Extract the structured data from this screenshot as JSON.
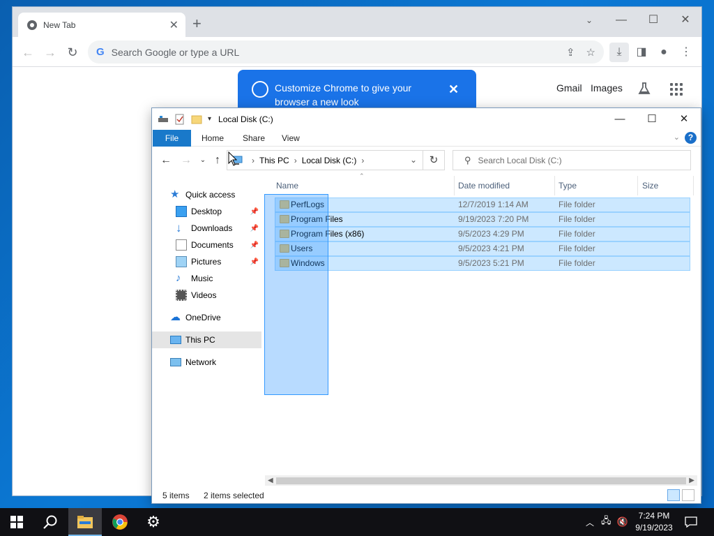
{
  "chrome": {
    "tab_title": "New Tab",
    "omnibox_placeholder": "Search Google or type a URL",
    "google_g": "G",
    "links": {
      "gmail": "Gmail",
      "images": "Images"
    },
    "promo_text": "Customize Chrome to give your browser a new look"
  },
  "explorer": {
    "title": "Local Disk (C:)",
    "ribbon_tabs": [
      "File",
      "Home",
      "Share",
      "View"
    ],
    "help": "?",
    "breadcrumb": [
      "This PC",
      "Local Disk (C:)"
    ],
    "search_placeholder": "Search Local Disk (C:)",
    "nav": [
      {
        "label": "Quick access"
      },
      {
        "label": "Desktop",
        "pinned": true
      },
      {
        "label": "Downloads",
        "pinned": true
      },
      {
        "label": "Documents",
        "pinned": true
      },
      {
        "label": "Pictures",
        "pinned": true
      },
      {
        "label": "Music"
      },
      {
        "label": "Videos"
      },
      {
        "label": "OneDrive"
      },
      {
        "label": "This PC",
        "selected": true
      },
      {
        "label": "Network"
      }
    ],
    "columns": [
      "Name",
      "Date modified",
      "Type",
      "Size"
    ],
    "files": [
      {
        "name": "PerfLogs",
        "date": "12/7/2019 1:14 AM",
        "type": "File folder"
      },
      {
        "name": "Program Files",
        "date": "9/19/2023 7:20 PM",
        "type": "File folder"
      },
      {
        "name": "Program Files (x86)",
        "date": "9/5/2023 4:29 PM",
        "type": "File folder"
      },
      {
        "name": "Users",
        "date": "9/5/2023 4:21 PM",
        "type": "File folder"
      },
      {
        "name": "Windows",
        "date": "9/5/2023 5:21 PM",
        "type": "File folder"
      }
    ],
    "status": {
      "items": "5 items",
      "selected": "2 items selected"
    }
  },
  "taskbar": {
    "time": "7:24 PM",
    "date": "9/19/2023"
  },
  "colors": {
    "accent": "#1979ca",
    "selection": "#cce8ff",
    "chrome_blue": "#1a73e8",
    "taskbar": "#101014"
  }
}
